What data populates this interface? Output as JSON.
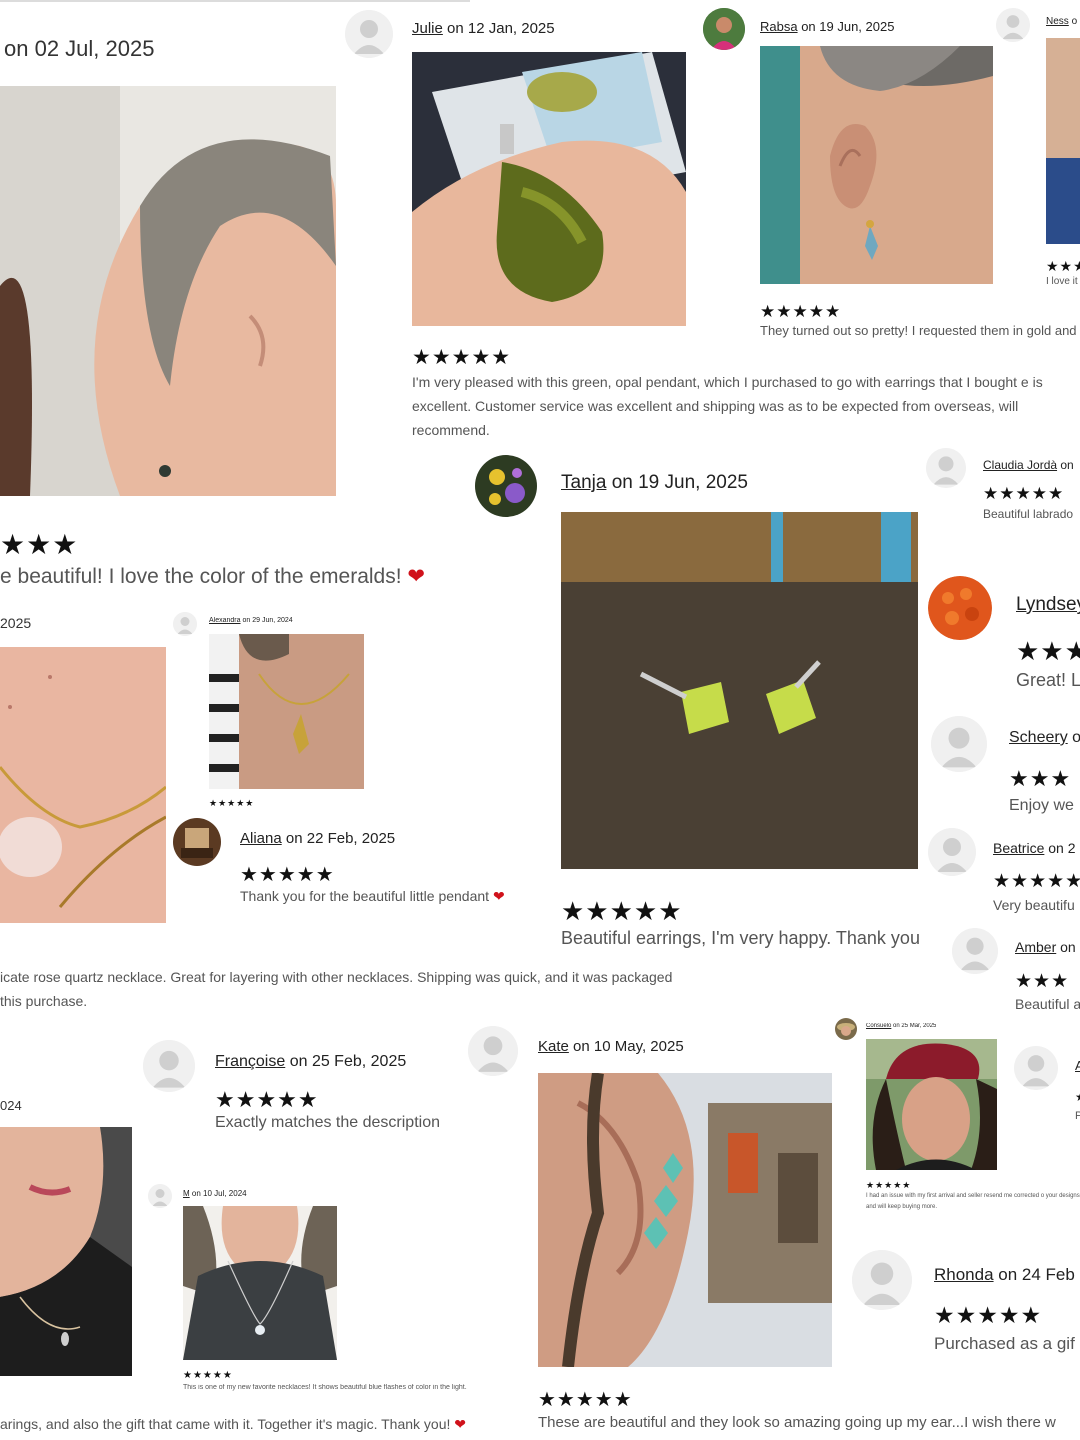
{
  "reviews": {
    "r1": {
      "meta": "on 02 Jul, 2025",
      "stars": "★★★",
      "text": "e beautiful! I love the color of the emeralds!"
    },
    "julie": {
      "name": "Julie",
      "meta": " on 12 Jan, 2025",
      "stars": "★★★★★",
      "text": "I'm very pleased with this green, opal pendant, which I purchased to go with earrings that I bought e is excellent. Customer service was excellent and shipping was as to be expected from overseas, will recommend."
    },
    "rabsa": {
      "name": "Rabsa",
      "meta": " on 19 Jun, 2025",
      "stars": "★★★★★",
      "text": "They turned out so pretty! I requested them in gold and"
    },
    "ness": {
      "name": "Ness",
      "meta": " o",
      "stars": "★★★",
      "text": "I love it"
    },
    "tanja": {
      "name": "Tanja",
      "meta": " on 19 Jun, 2025",
      "stars": "★★★★★",
      "text": "Beautiful earrings, I'm very happy. Thank you"
    },
    "claudia": {
      "name": "Claudia Jordà",
      "meta": " on",
      "stars": "★★★★★",
      "text": "Beautiful labrado"
    },
    "lyndsey": {
      "name": "Lyndsey",
      "stars": "★★★",
      "text": "Great! L"
    },
    "scheery": {
      "name": "Scheery",
      "meta": " o",
      "stars": "★★★",
      "text": "Enjoy we"
    },
    "beatrice": {
      "name": "Beatrice",
      "meta": " on 2",
      "stars": "★★★★★",
      "text": "Very beautifu"
    },
    "amber": {
      "name": "Amber",
      "meta": " on",
      "stars": "★★★",
      "text": "Beautiful a"
    },
    "r2025": {
      "meta": "2025"
    },
    "alexandra": {
      "name": "Alexandra",
      "meta": " on 29 Jun, 2024",
      "stars": "★★★★★"
    },
    "aliana": {
      "name": "Aliana",
      "meta": " on 22 Feb, 2025",
      "stars": "★★★★★",
      "text": "Thank you for the beautiful little pendant"
    },
    "rosequartz": {
      "line1": "icate rose quartz necklace. Great for layering with other necklaces. Shipping was quick, and it was packaged",
      "line2": " this purchase."
    },
    "francoise": {
      "name": "Françoise",
      "meta": " on 25 Feb, 2025",
      "stars": "★★★★★",
      "text": "Exactly matches the description"
    },
    "r024": {
      "meta": "024"
    },
    "m": {
      "name": "M",
      "meta": " on 10 Jul, 2024",
      "stars": "★★★★★",
      "text": "This is one of my new favorite necklaces! It shows beautiful blue flashes of color in the light."
    },
    "bottomleft": {
      "text": "arings, and also the gift that came with it. Together it's magic. Thank you!"
    },
    "kate": {
      "name": "Kate",
      "meta": " on 10 May, 2025",
      "stars": "★★★★★",
      "text": "These are beautiful and they look so amazing going up my ear...I wish there w"
    },
    "consuelo": {
      "name": "Consuelo",
      "meta": " on 25 Mar, 2025",
      "stars": "★★★★★",
      "text": "I had an issue with my first arrival and seller resend me corrected o your designs and will keep buying more."
    },
    "rhonda": {
      "name": "Rhonda",
      "meta": " on 24 Feb",
      "stars": "★★★★★",
      "text": "Purchased as a gif"
    },
    "partialA": {
      "name": "A",
      "stars": "★",
      "text": "P"
    }
  },
  "icons": {
    "heart": "heart-icon",
    "avatar": "avatar-placeholder-icon"
  },
  "colors": {
    "heart": "#d0121b",
    "stars": "#111111",
    "link": "#222222",
    "text": "#555555"
  }
}
